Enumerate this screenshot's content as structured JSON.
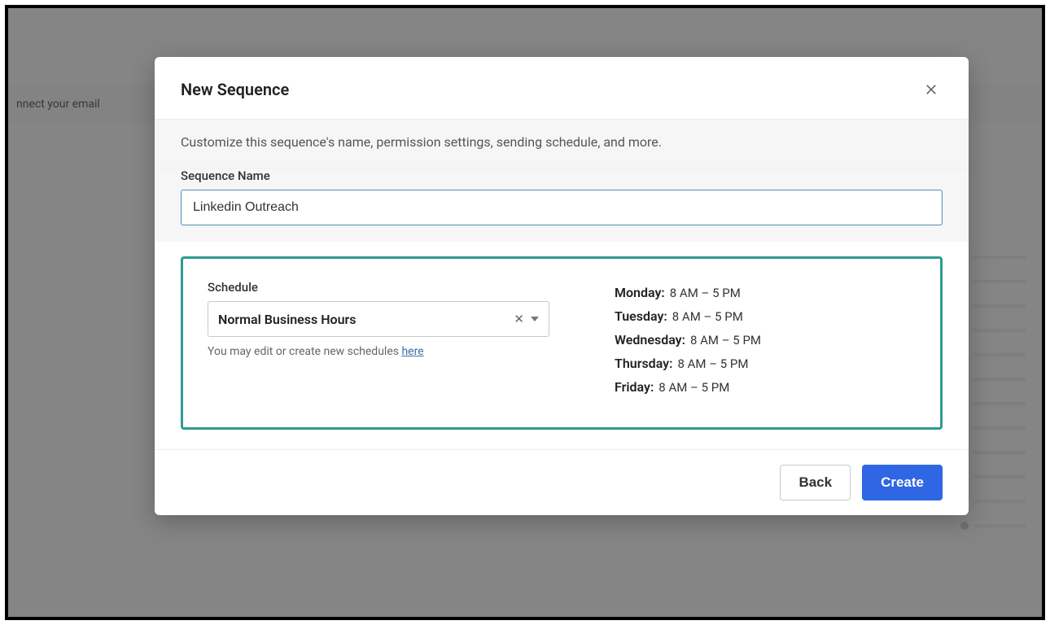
{
  "background": {
    "banner_text": "nnect your email"
  },
  "modal": {
    "title": "New Sequence",
    "description": "Customize this sequence's name, permission settings, sending schedule, and more.",
    "sequence_name_label": "Sequence Name",
    "sequence_name_value": "Linkedin Outreach",
    "schedule": {
      "label": "Schedule",
      "selected": "Normal Business Hours",
      "hint_prefix": "You may edit or create new schedules ",
      "hint_link": "here",
      "days": [
        {
          "day": "Monday:",
          "time": "8 AM – 5 PM"
        },
        {
          "day": "Tuesday:",
          "time": "8 AM – 5 PM"
        },
        {
          "day": "Wednesday:",
          "time": "8 AM – 5 PM"
        },
        {
          "day": "Thursday:",
          "time": "8 AM – 5 PM"
        },
        {
          "day": "Friday:",
          "time": "8 AM – 5 PM"
        }
      ]
    },
    "buttons": {
      "back": "Back",
      "create": "Create"
    }
  }
}
